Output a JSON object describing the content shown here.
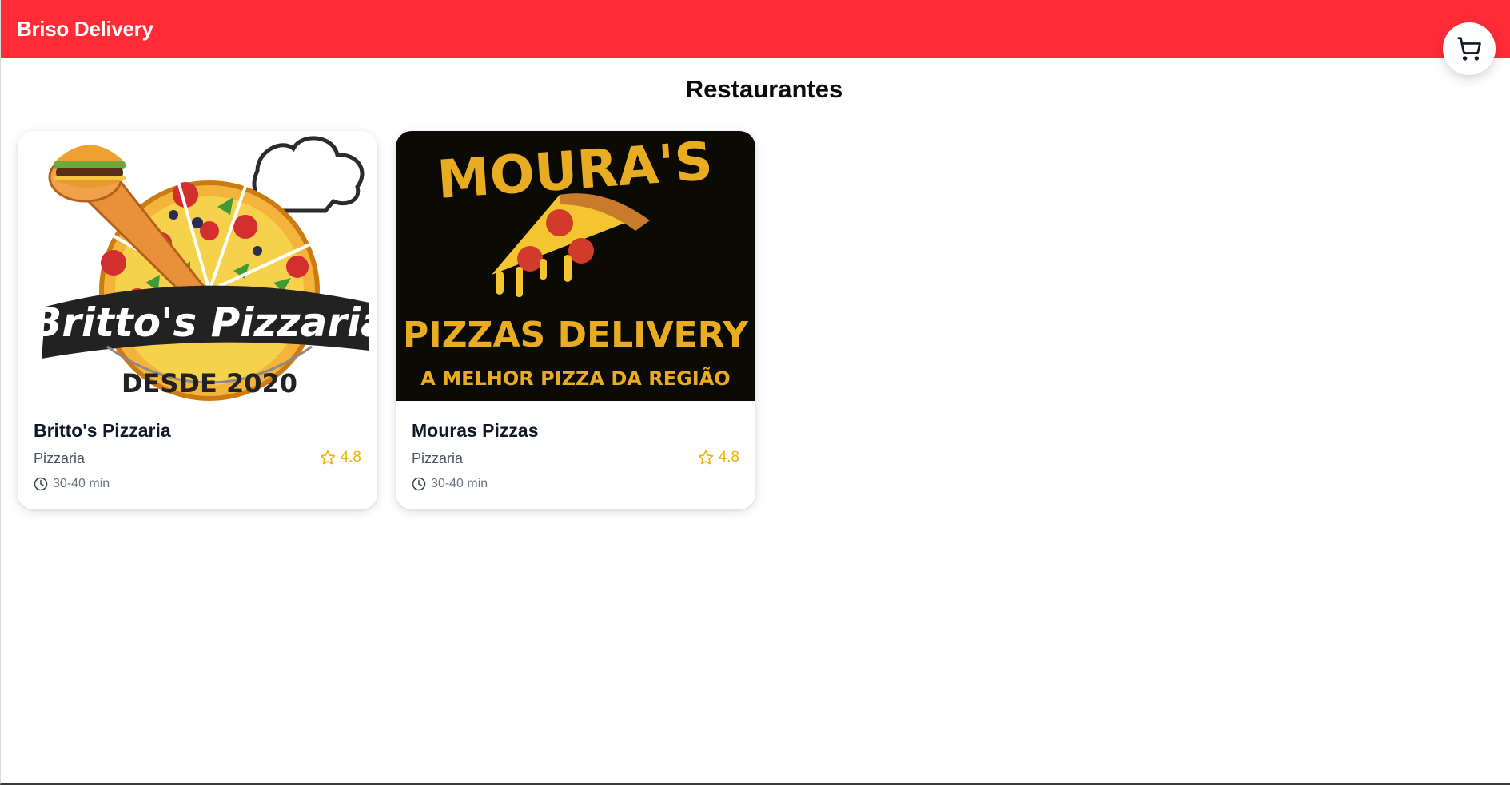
{
  "header": {
    "brand": "Briso Delivery"
  },
  "cart": {
    "icon": "shopping-cart-icon"
  },
  "main": {
    "title": "Restaurantes"
  },
  "restaurants": [
    {
      "name": "Britto's Pizzaria",
      "category": "Pizzaria",
      "rating": "4.8",
      "time": "30-40 min",
      "logo": {
        "main": "Britto's Pizzaria",
        "sub": "DESDE 2020"
      }
    },
    {
      "name": "Mouras Pizzas",
      "category": "Pizzaria",
      "rating": "4.8",
      "time": "30-40 min",
      "logo": {
        "main": "MOURA'S",
        "mid": "PIZZAS DELIVERY",
        "sub": "A MELHOR PIZZA DA REGIÃO"
      }
    }
  ],
  "colors": {
    "header": "#ff2c38",
    "rating": "#eab308",
    "logo_gold": "#e8ac22",
    "logo_bg": "#0b0a05"
  }
}
